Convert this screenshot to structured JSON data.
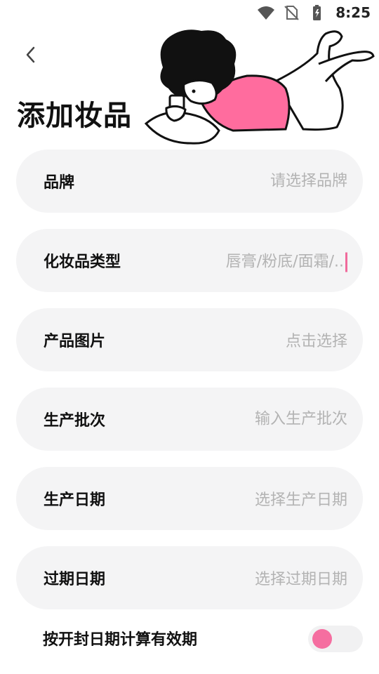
{
  "status_bar": {
    "time": "8:25",
    "icons": [
      "wifi-icon",
      "no-sim-icon",
      "battery-charging-icon"
    ]
  },
  "header": {
    "back_icon": "chevron-left-icon",
    "title": "添加妆品"
  },
  "form": {
    "brand": {
      "label": "品牌",
      "placeholder": "请选择品牌"
    },
    "type": {
      "label": "化妆品类型",
      "placeholder": "唇膏/粉底/面霜/.."
    },
    "image": {
      "label": "产品图片",
      "value": "点击选择"
    },
    "batch": {
      "label": "生产批次",
      "placeholder": "输入生产批次"
    },
    "production_date": {
      "label": "生产日期",
      "value": "选择生产日期"
    },
    "expiry_date": {
      "label": "过期日期",
      "value": "选择过期日期"
    }
  },
  "toggle": {
    "label": "按开封日期计算有效期",
    "on": false
  },
  "colors": {
    "accent": "#f56ea0",
    "row_bg": "#f4f4f5",
    "placeholder": "#b3b3b3",
    "illustration_shirt": "#ff6c9e"
  }
}
